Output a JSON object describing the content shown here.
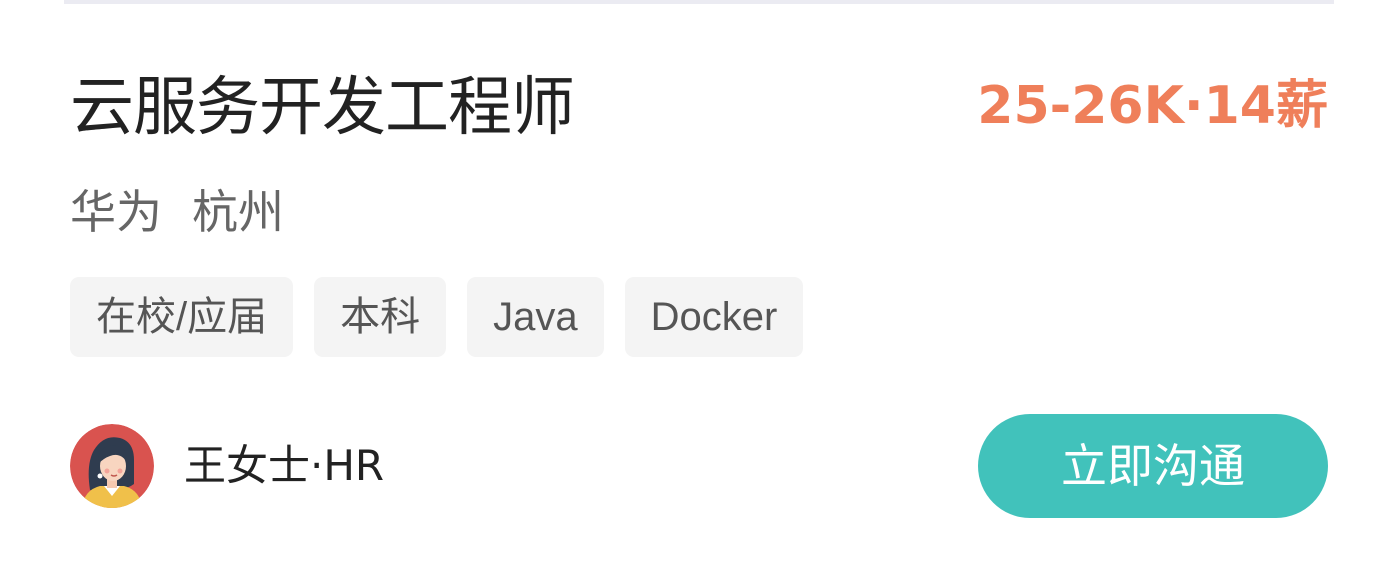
{
  "job": {
    "title": "云服务开发工程师",
    "salary": "25-26K·14薪",
    "company": "华为",
    "city": "杭州",
    "tags": [
      "在校/应届",
      "本科",
      "Java",
      "Docker"
    ]
  },
  "recruiter": {
    "name": "王女士·HR",
    "avatar_icon": "recruiter-avatar-icon"
  },
  "actions": {
    "chat_label": "立即沟通"
  },
  "colors": {
    "salary": "#ef7f5a",
    "button": "#41c2bb",
    "title": "#222222",
    "secondary_text": "#666666",
    "tag_background": "#f4f4f4",
    "avatar_background": "#d9534f"
  }
}
